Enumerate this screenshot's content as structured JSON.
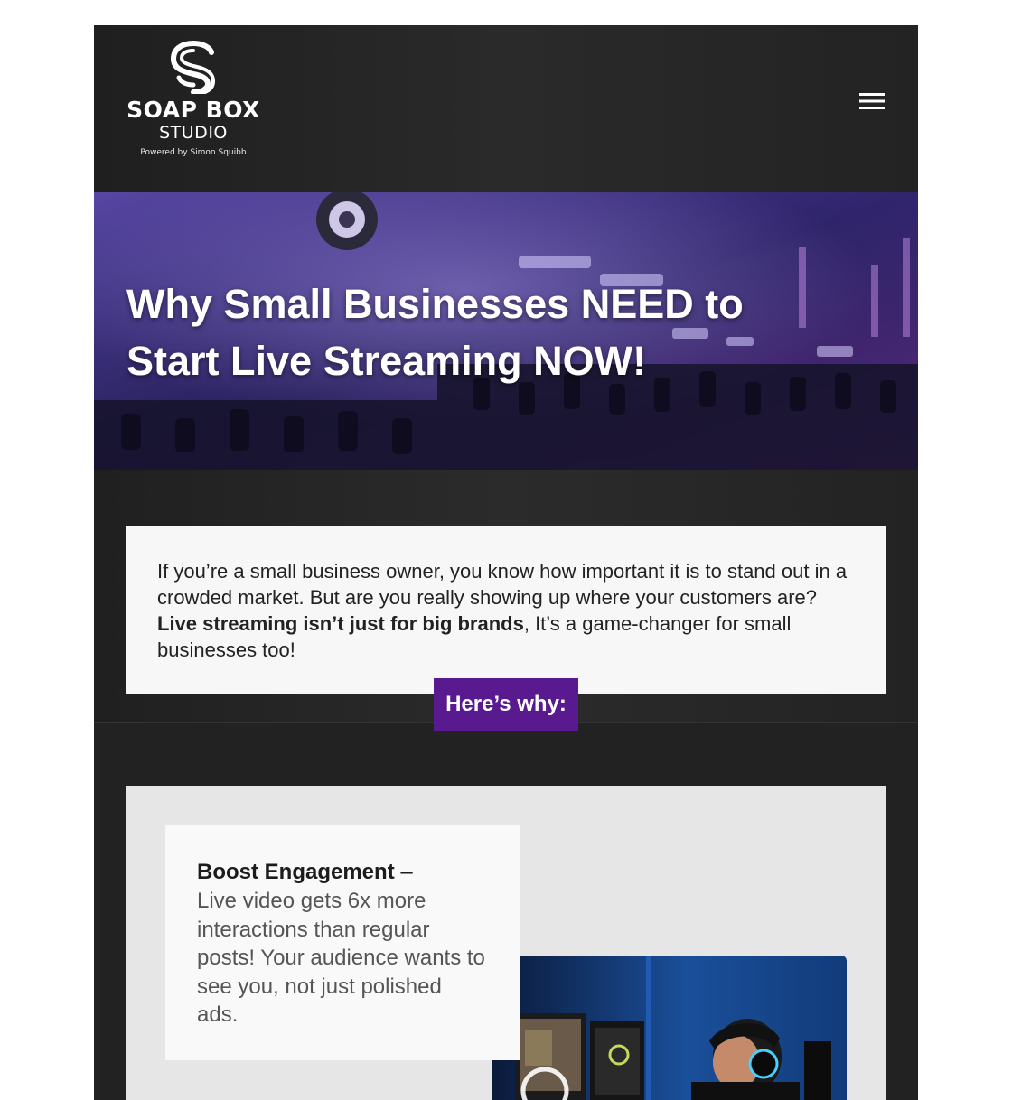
{
  "header": {
    "logo": {
      "mark": "S",
      "name": "SOAP BOX",
      "sub": "STUDIO",
      "powered": "Powered by Simon Squibb"
    },
    "menu_icon": "hamburger-menu-icon"
  },
  "hero": {
    "title": "Why Small Businesses NEED to Start Live Streaming NOW!",
    "image": "audio-mixing-console-photo"
  },
  "intro": {
    "text_before": "If you’re a small business owner, you know how important it is to stand out in a crowded market. But are you really showing up where your customers are? ",
    "text_bold": "Live streaming isn’t just for big brands",
    "text_after": ", It’s a game-changer for small businesses too!",
    "badge": "Here’s why:"
  },
  "feature": {
    "title": "Boost Engagement",
    "dash": " –",
    "body": "Live video gets 6x more interactions than regular posts! Your audience wants to see you, not just polished ads.",
    "image": "streamer-with-headset-photo"
  },
  "colors": {
    "accent_purple": "#5a1a8f",
    "header_bg": "#222222",
    "card_bg": "#f7f7f7",
    "section_bg": "#e6e6e6"
  }
}
